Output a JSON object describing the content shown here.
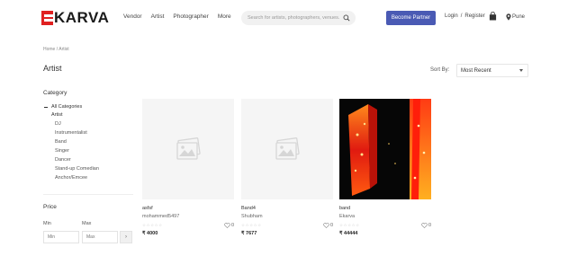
{
  "logo": {
    "mark": "E",
    "text": "KARVA"
  },
  "nav": {
    "items": [
      "Vendor",
      "Artist",
      "Photographer",
      "More"
    ]
  },
  "search": {
    "placeholder": "Search for artists, photographers, venues..."
  },
  "header": {
    "partner_label": "Become Partner",
    "login_label": "Login",
    "separator": "/",
    "register_label": "Register",
    "location": "Pune"
  },
  "breadcrumb": "Home / Artist",
  "page_title": "Artist",
  "sort": {
    "label": "Sort By:",
    "value": "Most Recent"
  },
  "sidebar": {
    "category_heading": "Category",
    "all_categories": "All Categories",
    "artist": "Artist",
    "subcategories": [
      "DJ",
      "Instrumentalist",
      "Band",
      "Singer",
      "Dancer",
      "Stand-up Comedian",
      "Anchor/Emcee"
    ],
    "price_heading": "Price",
    "min_label": "Min",
    "max_label": "Max",
    "min_placeholder": "Min",
    "max_placeholder": "Max",
    "go_label": "›"
  },
  "cards": [
    {
      "name": "asfsf",
      "vendor": "mohammed5497",
      "likes": "0",
      "price": "₹ 4000",
      "image": "placeholder-icon"
    },
    {
      "name": "Band4",
      "vendor": "Shubham",
      "likes": "0",
      "price": "₹ 7677",
      "image": "placeholder-icon"
    },
    {
      "name": "band",
      "vendor": "Ekarva",
      "likes": "0",
      "price": "₹ 44444",
      "image": "red-lights-photo"
    }
  ],
  "colors": {
    "brand_red": "#e02020",
    "partner_button": "#4a5ab4"
  }
}
